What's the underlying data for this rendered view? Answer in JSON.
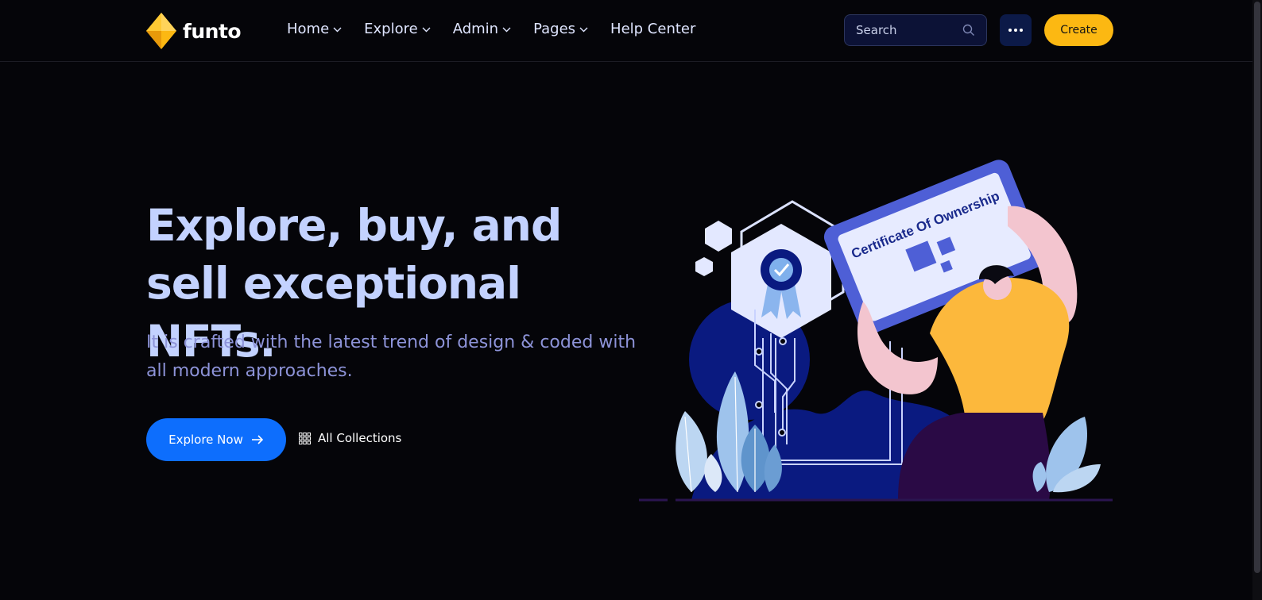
{
  "brand": {
    "name": "funto",
    "logo_icon": "diamond-logo-icon",
    "accent_color": "#fcb812"
  },
  "nav": {
    "items": [
      {
        "label": "Home",
        "has_dropdown": true
      },
      {
        "label": "Explore",
        "has_dropdown": true
      },
      {
        "label": "Admin",
        "has_dropdown": true
      },
      {
        "label": "Pages",
        "has_dropdown": true
      },
      {
        "label": "Help Center",
        "has_dropdown": false
      }
    ],
    "search": {
      "placeholder": "Search",
      "icon": "search-icon"
    },
    "more_icon": "more-dots-icon",
    "create_label": "Create"
  },
  "hero": {
    "title": "Explore, buy, and sell exceptional NFTs.",
    "subtitle": "It is crafted with the latest trend of design & coded with all modern approaches.",
    "primary_button": {
      "label": "Explore Now",
      "icon": "arrow-right-icon",
      "color": "#0d6efd"
    },
    "secondary_link": {
      "label": "All Collections",
      "icon": "grid-icon"
    }
  },
  "illustration": {
    "certificate_text": "Certificate Of Ownership",
    "colors": {
      "card": "#4e5fd6",
      "shirt": "#fcb83c",
      "blob": "#0a1a80",
      "leaves": "#9ec3ec"
    }
  }
}
